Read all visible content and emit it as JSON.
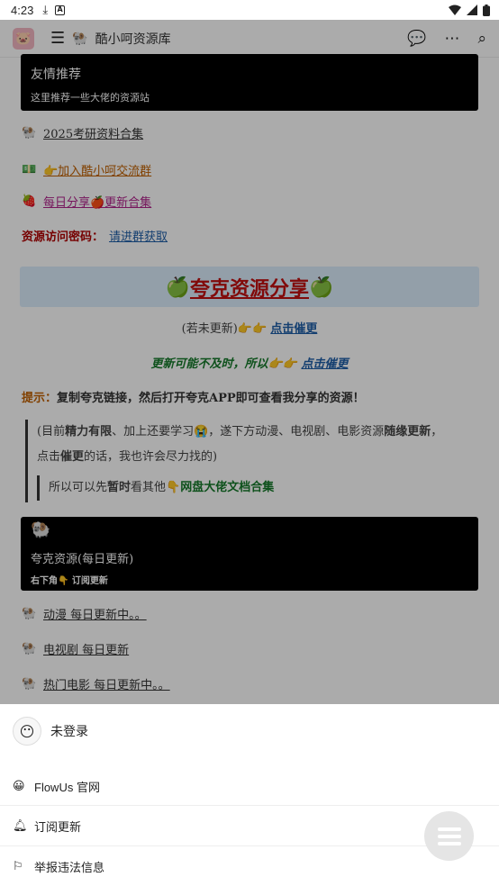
{
  "status_bar": {
    "time": "4:23"
  },
  "topbar": {
    "title": "酷小呵资源库"
  },
  "content": {
    "card1": {
      "title": "友情推荐",
      "subtitle": "这里推荐一些大佬的资源站"
    },
    "rows": [
      {
        "emoji": "🐏",
        "text": "2025考研资料合集"
      },
      {
        "emoji": "💵",
        "text": "👉加入酷小呵交流群"
      },
      {
        "emoji": "🍓",
        "text": "每日分享🍎更新合集"
      }
    ],
    "password": {
      "label": "资源访问密码：",
      "link": "请进群获取"
    },
    "banner": {
      "text": "夸克资源分享"
    },
    "not_updated": {
      "prefix": "(若未更新)👉👉 ",
      "link": "点击催更"
    },
    "delay": {
      "text": "更新可能不及时，所以👉👉 ",
      "link": "点击催更"
    },
    "tip": {
      "label": "提示：",
      "text": "复制夸克链接，然后打开夸克APP即可查看我分享的资源！"
    },
    "quote": {
      "line1_a": "(目前",
      "line1_b": "精力有限",
      "line1_c": "、加上还要学习😭，遂下方动漫、电视剧、电影资源",
      "line1_d": "随缘更新",
      "line1_e": "，",
      "line2_a": "点击",
      "line2_b": "催更",
      "line2_c": "的话，我也许会尽力找的)",
      "inner_a": "所以可以先",
      "inner_b": "暂时",
      "inner_c": "看其他👇",
      "inner_link": "网盘大佬文档合集"
    },
    "card2": {
      "title": "夸克资源(每日更新)",
      "subtitle": "右下角👇 订阅更新"
    },
    "rows2": [
      {
        "emoji": "🐏",
        "text": "动漫 每日更新中。。"
      },
      {
        "emoji": "🐏",
        "text": "电视剧 每日更新"
      },
      {
        "emoji": "🐏",
        "text": "热门电影 每日更新中。。"
      }
    ]
  },
  "sheet": {
    "login": "未登录",
    "items": [
      {
        "icon": "flowus-logo-icon",
        "label": "FlowUs 官网"
      },
      {
        "icon": "bell-icon",
        "label": "订阅更新"
      },
      {
        "icon": "report-icon",
        "label": "举报违法信息"
      }
    ]
  }
}
